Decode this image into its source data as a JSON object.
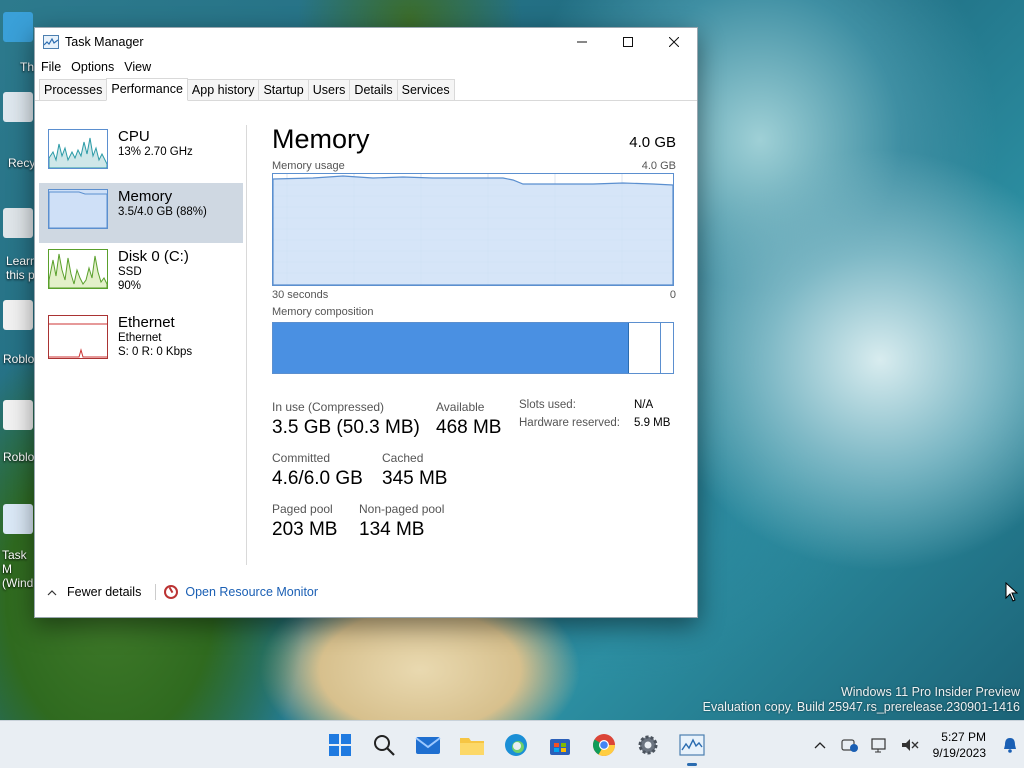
{
  "desktop": {
    "icon_labels": [
      "Th",
      "Recy",
      "Learn this p",
      "Roblo",
      "Roblo",
      "Task M (Wind"
    ],
    "watermark_line1": "Windows 11 Pro Insider Preview",
    "watermark_line2": "Evaluation copy. Build 25947.rs_prerelease.230901-1416"
  },
  "window": {
    "title": "Task Manager",
    "controls": {
      "minimize": "—",
      "maximize": "☐",
      "close": "✕"
    },
    "menu": [
      "File",
      "Options",
      "View"
    ],
    "tabs": [
      "Processes",
      "Performance",
      "App history",
      "Startup",
      "Users",
      "Details",
      "Services"
    ],
    "active_tab": "Performance"
  },
  "sidebar": {
    "items": [
      {
        "title": "CPU",
        "line1": "13%  2.70 GHz",
        "line2": ""
      },
      {
        "title": "Memory",
        "line1": "3.5/4.0 GB (88%)",
        "line2": ""
      },
      {
        "title": "Disk 0 (C:)",
        "line1": "SSD",
        "line2": "90%"
      },
      {
        "title": "Ethernet",
        "line1": "Ethernet",
        "line2": "S: 0  R: 0 Kbps"
      }
    ],
    "selected_index": 1
  },
  "main": {
    "title": "Memory",
    "total": "4.0 GB",
    "usage_label": "Memory usage",
    "usage_max": "4.0 GB",
    "axis_left": "30 seconds",
    "axis_right": "0",
    "composition_label": "Memory composition",
    "composition": {
      "in_use_fraction": 0.89,
      "modified_fraction": 0.08
    },
    "stats": {
      "in_use_label": "In use (Compressed)",
      "in_use_value": "3.5 GB (50.3 MB)",
      "available_label": "Available",
      "available_value": "468 MB",
      "committed_label": "Committed",
      "committed_value": "4.6/6.0 GB",
      "cached_label": "Cached",
      "cached_value": "345 MB",
      "paged_label": "Paged pool",
      "paged_value": "203 MB",
      "nonpaged_label": "Non-paged pool",
      "nonpaged_value": "134 MB",
      "slots_label": "Slots used:",
      "slots_value": "N/A",
      "hw_reserved_label": "Hardware reserved:",
      "hw_reserved_value": "5.9 MB"
    }
  },
  "footer": {
    "fewer_details": "Fewer details",
    "open_resource_monitor": "Open Resource Monitor"
  },
  "taskbar": {
    "time": "5:27 PM",
    "date": "9/19/2023",
    "apps": [
      "start-icon",
      "search-icon",
      "mail-icon",
      "file-explorer-icon",
      "edge-icon",
      "store-icon",
      "chrome-icon",
      "settings-icon",
      "task-manager-icon"
    ]
  },
  "colors": {
    "accent": "#4a90e2",
    "graph_fill": "#cfe0f7",
    "graph_border": "#5b8fcf",
    "selected_bg": "#cfd8e2",
    "link": "#1a5fb4"
  }
}
